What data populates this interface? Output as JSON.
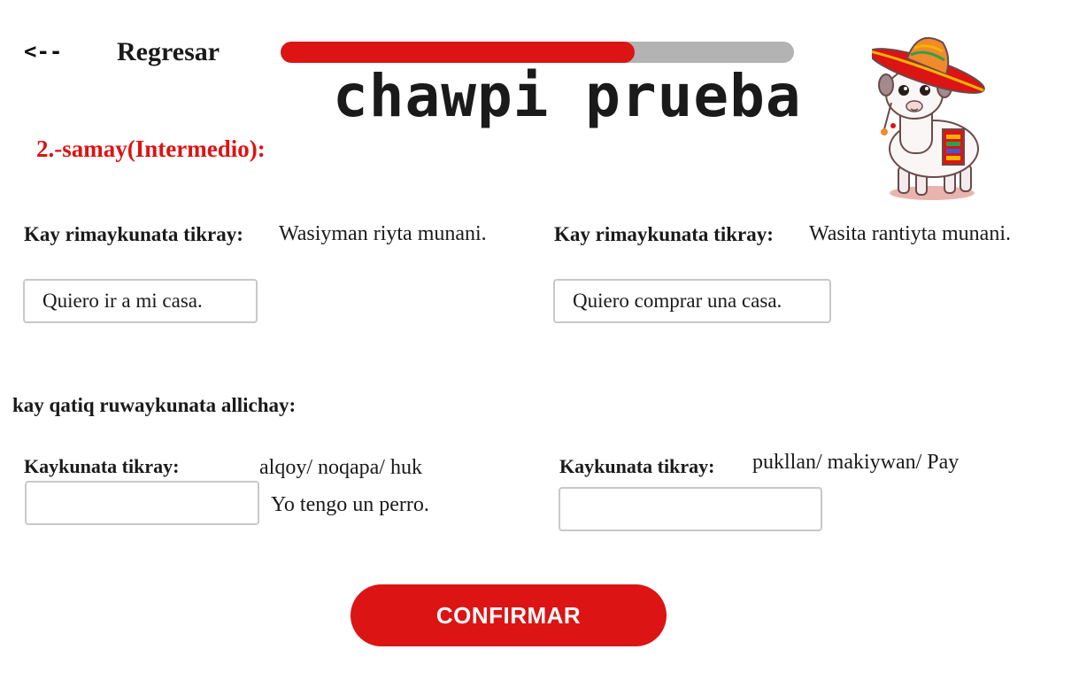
{
  "header": {
    "back_arrow": "<--",
    "back_label": "Regresar",
    "progress": 0.69,
    "title": "chawpi prueba"
  },
  "section": {
    "title": "2.-samay(Intermedio):"
  },
  "translate": {
    "items": [
      {
        "instruction": "Kay rimaykunata tikray:",
        "phrase": "Wasiyman riyta munani.",
        "answer": "Quiero ir a mi casa."
      },
      {
        "instruction": "Kay rimaykunata tikray:",
        "phrase": "Wasita rantiyta munani.",
        "answer": "Quiero comprar una casa."
      }
    ]
  },
  "complete": {
    "heading": "kay qatiq ruwaykunata allichay:",
    "items": [
      {
        "instruction": "Kaykunata tikray:",
        "words": "alqoy/ noqapa/ huk",
        "hint": "Yo tengo un perro.",
        "value": ""
      },
      {
        "instruction": "Kaykunata tikray:",
        "words": "pukllan/ makiywan/ Pay",
        "value": ""
      }
    ]
  },
  "confirm_label": "CONFIRMAR",
  "colors": {
    "accent": "#dc1414",
    "progress_track": "#b3b3b3"
  },
  "mascot": "llama-with-sombrero-icon"
}
